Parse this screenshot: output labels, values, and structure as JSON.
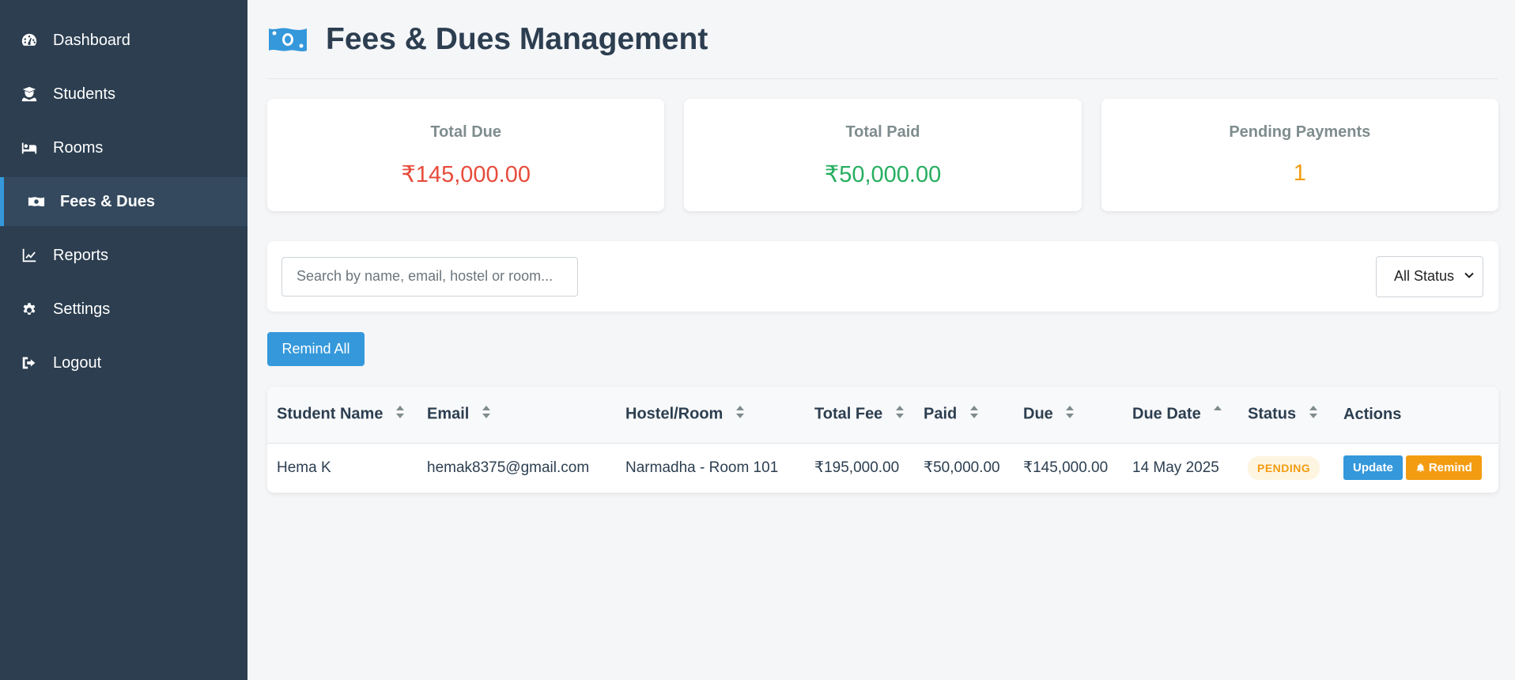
{
  "sidebar": {
    "items": [
      {
        "label": "Dashboard",
        "icon": "tachometer-icon"
      },
      {
        "label": "Students",
        "icon": "user-graduate-icon"
      },
      {
        "label": "Rooms",
        "icon": "bed-icon"
      },
      {
        "label": "Fees & Dues",
        "icon": "money-bill-icon",
        "active": true
      },
      {
        "label": "Reports",
        "icon": "chart-line-icon"
      },
      {
        "label": "Settings",
        "icon": "gear-icon"
      },
      {
        "label": "Logout",
        "icon": "sign-out-icon"
      }
    ]
  },
  "header": {
    "title": "Fees & Dues Management",
    "icon": "money-bill-icon"
  },
  "summary": {
    "total_due": {
      "label": "Total Due",
      "value": "₹145,000.00",
      "color": "#e74c3c"
    },
    "total_paid": {
      "label": "Total Paid",
      "value": "₹50,000.00",
      "color": "#27ae60"
    },
    "pending": {
      "label": "Pending Payments",
      "value": "1",
      "color": "#f39c12"
    }
  },
  "filters": {
    "search_placeholder": "Search by name, email, hostel or room...",
    "status_selected": "All Status"
  },
  "actions": {
    "remind_all": "Remind All"
  },
  "table": {
    "columns": [
      "Student Name",
      "Email",
      "Hostel/Room",
      "Total Fee",
      "Paid",
      "Due",
      "Due Date",
      "Status",
      "Actions"
    ],
    "rows": [
      {
        "student_name": "Hema K",
        "email": "hemak8375@gmail.com",
        "hostel_room": "Narmadha - Room 101",
        "total_fee": "₹195,000.00",
        "paid": "₹50,000.00",
        "due": "₹145,000.00",
        "due_date": "14 May 2025",
        "status": "PENDING",
        "update_label": "Update",
        "remind_label": "Remind"
      }
    ]
  },
  "colors": {
    "sidebar_bg": "#2c3e50",
    "accent": "#3498db",
    "warning": "#f39c12"
  }
}
